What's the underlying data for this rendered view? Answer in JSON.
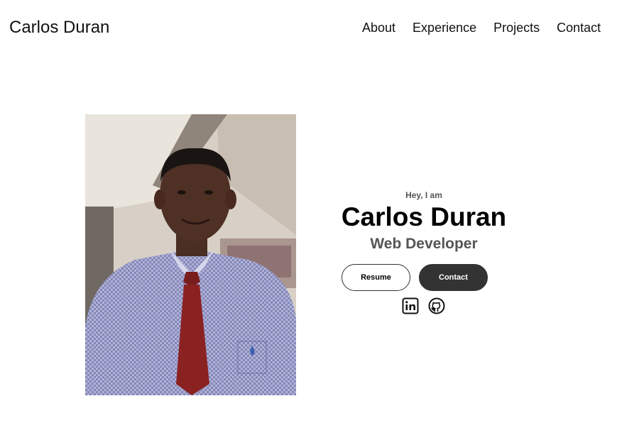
{
  "nav": {
    "logo": "Carlos Duran",
    "links": [
      {
        "label": "About"
      },
      {
        "label": "Experience"
      },
      {
        "label": "Projects"
      },
      {
        "label": "Contact"
      }
    ]
  },
  "profile": {
    "greeting": "Hey, I am",
    "name": "Carlos Duran",
    "title": "Web Developer",
    "buttons": {
      "resume": "Resume",
      "contact": "Contact"
    },
    "socials": [
      {
        "icon": "linkedin-icon"
      },
      {
        "icon": "github-icon"
      }
    ]
  },
  "colors": {
    "text": "#000000",
    "muted": "#555555",
    "button_dark": "#333333",
    "background": "#ffffff"
  }
}
